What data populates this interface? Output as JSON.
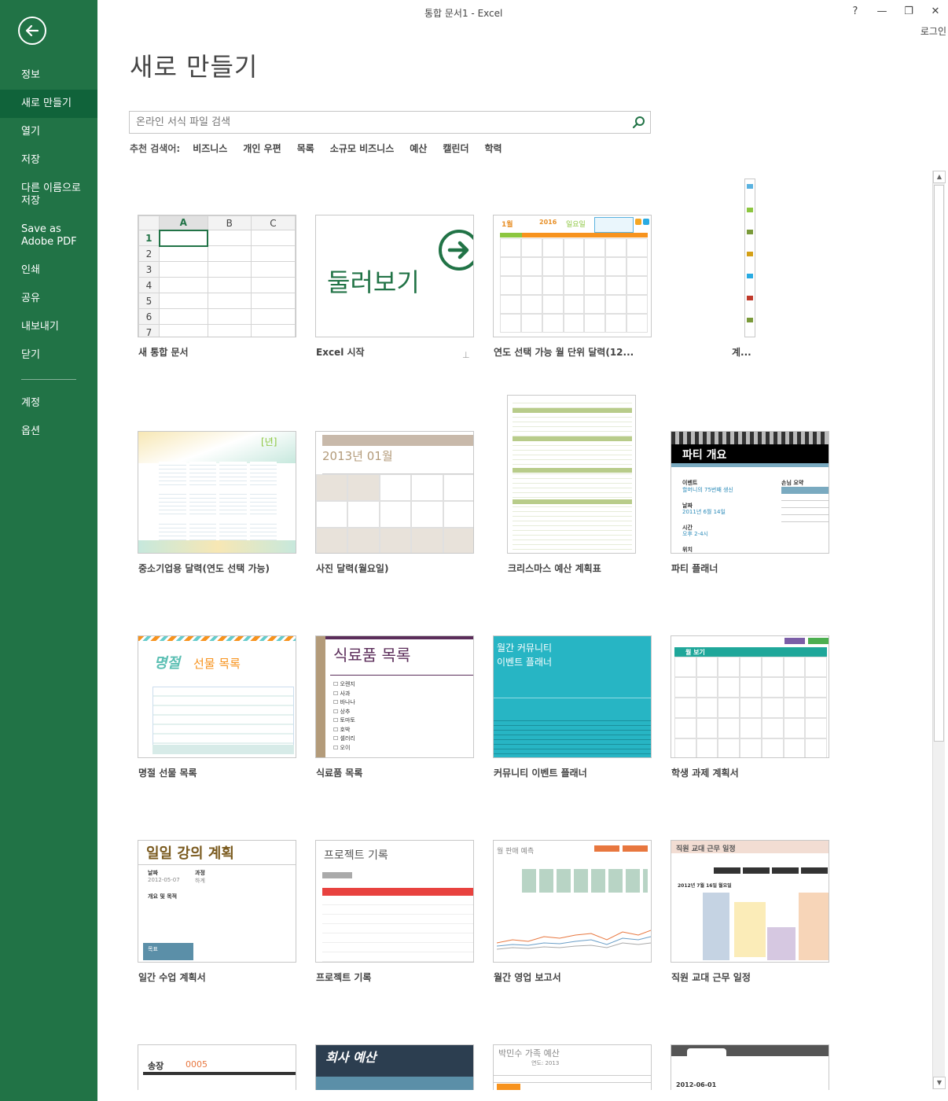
{
  "window": {
    "title": "통합 문서1 - Excel",
    "help": "?",
    "minimize": "—",
    "restore": "❐",
    "close": "✕",
    "signin": "로그인"
  },
  "sidebar": {
    "items": [
      {
        "label": "정보"
      },
      {
        "label": "새로 만들기"
      },
      {
        "label": "열기"
      },
      {
        "label": "저장"
      },
      {
        "label": "다른 이름으로 저장"
      },
      {
        "label": "Save as Adobe PDF"
      },
      {
        "label": "인쇄"
      },
      {
        "label": "공유"
      },
      {
        "label": "내보내기"
      },
      {
        "label": "닫기"
      },
      {
        "label": "계정"
      },
      {
        "label": "옵션"
      }
    ]
  },
  "main": {
    "title": "새로 만들기",
    "search_placeholder": "온라인 서식 파일 검색",
    "suggest_label": "추천 검색어:",
    "suggestions": [
      "비즈니스",
      "개인 우편",
      "목록",
      "소규모 비즈니스",
      "예산",
      "캘린더",
      "학력"
    ]
  },
  "templates": {
    "blank": {
      "label": "새 통합 문서",
      "cols": [
        "A",
        "B",
        "C"
      ],
      "rows": [
        "1",
        "2",
        "3",
        "4",
        "5",
        "6",
        "7"
      ]
    },
    "tour": {
      "label": "Excel 시작",
      "thumb_text": "둘러보기"
    },
    "calendar_year": {
      "label": "연도 선택 가능 월 단위 달력(12...",
      "month": "1월",
      "year": "2016",
      "weekday": "일요일"
    },
    "calendar_tall": {
      "label": "계..."
    },
    "smb_calendar": {
      "label": "중소기업용 달력(연도 선택 가능)",
      "badge": "[년]"
    },
    "photo_calendar": {
      "label": "사진 달력(월요일)",
      "date": "2013년 01월"
    },
    "xmas_budget": {
      "label": "크리스마스 예산 계획표"
    },
    "party": {
      "label": "파티 플래너",
      "header": "파티 개요",
      "event_lbl": "이벤트",
      "event_val": "할머니의 75번째 생신",
      "date_lbl": "날짜",
      "date_val": "2011년 6월 14일",
      "time_lbl": "시간",
      "time_val": "오후 2-4시",
      "place_lbl": "위치",
      "guest_lbl": "손님 요약"
    },
    "gift_list": {
      "label": "명절 선물 목록",
      "title_a": "명절",
      "title_b": "선물 목록"
    },
    "grocery": {
      "label": "식료품 목록",
      "header": "식료품 목록",
      "items": [
        "오렌지",
        "사과",
        "바나나",
        "상추",
        "토마토",
        "호박",
        "셀러리",
        "오이"
      ]
    },
    "community": {
      "label": "커뮤니티 이벤트 플래너",
      "line1": "월간 커뮤니티",
      "line2": "이벤트 플래너"
    },
    "student": {
      "label": "학생 과제 계획서",
      "header": "월 보기"
    },
    "lecture": {
      "label": "일간 수업 계획서",
      "header": "일일 강의 계획",
      "date_lbl": "날짜",
      "course_lbl": "과정",
      "date_val": "2012-05-07",
      "course_val": "하계",
      "overview": "개요 및 목적",
      "goal": "목표"
    },
    "project": {
      "label": "프로젝트 기록",
      "header": "프로젝트 기록"
    },
    "sales": {
      "label": "월간 영업 보고서",
      "header": "월 판매 예측"
    },
    "shift": {
      "label": "직원 교대 근무 일정",
      "header": "직원 교대 근무 일정",
      "date": "2012년 7월 16일 월요일"
    },
    "invoice": {
      "label": "",
      "header": "송장",
      "num": "0005"
    },
    "company_budget": {
      "label": "",
      "header": "회사 예산"
    },
    "family_budget": {
      "label": "",
      "header": "박민수 가족 예산",
      "year": "연도: 2013"
    },
    "log": {
      "label": "",
      "date": "2012-06-01"
    }
  },
  "colors": {
    "accent": "#217346",
    "accent_dark": "#10633a"
  }
}
